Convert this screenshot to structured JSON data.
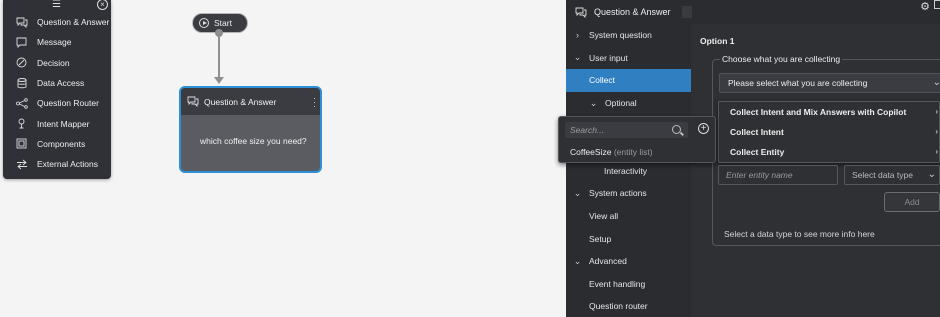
{
  "palette": {
    "items": [
      {
        "label": "Question & Answer",
        "icon": "chat-bubbles-icon"
      },
      {
        "label": "Message",
        "icon": "message-icon"
      },
      {
        "label": "Decision",
        "icon": "decision-icon"
      },
      {
        "label": "Data Access",
        "icon": "database-icon"
      },
      {
        "label": "Question Router",
        "icon": "router-icon"
      },
      {
        "label": "Intent Mapper",
        "icon": "intent-mapper-icon"
      },
      {
        "label": "Components",
        "icon": "components-icon"
      },
      {
        "label": "External Actions",
        "icon": "external-actions-icon"
      }
    ]
  },
  "flow": {
    "start_label": "Start",
    "qa_node": {
      "title": "Question & Answer",
      "body": "which coffee size you need?"
    }
  },
  "panel": {
    "title": "Question & Answer",
    "nav": [
      {
        "label": "System question",
        "type": "section",
        "chev": "›"
      },
      {
        "label": "User input",
        "type": "section",
        "chev": "⌄"
      },
      {
        "label": "Collect",
        "type": "sub",
        "active": true
      },
      {
        "label": "Optional",
        "type": "sub-chev",
        "chev": "⌄"
      },
      {
        "label": "",
        "type": "sub2"
      },
      {
        "label": "",
        "type": "sub2"
      },
      {
        "label": "Interactivity",
        "type": "sub2"
      },
      {
        "label": "System actions",
        "type": "section",
        "chev": "⌄"
      },
      {
        "label": "View all",
        "type": "sub"
      },
      {
        "label": "Setup",
        "type": "sub"
      },
      {
        "label": "Advanced",
        "type": "section",
        "chev": "⌄"
      },
      {
        "label": "Event handling",
        "type": "sub"
      },
      {
        "label": "Question router",
        "type": "sub"
      }
    ],
    "option_title": "Option 1",
    "collect_legend": "Choose what you are collecting",
    "collect_select_value": "Please select what you are collecting",
    "dropdown_options": [
      "Collect Intent and Mix Answers with Copilot",
      "Collect Intent",
      "Collect Entity"
    ],
    "entity_name_placeholder": "Enter entity name",
    "data_type_value": "Select data type",
    "add_label": "Add",
    "hint": "Select a data type to see more info here"
  },
  "search_popup": {
    "placeholder": "Search...",
    "result_name": "CoffeeSize",
    "result_type": "(entity list)"
  },
  "colors": {
    "accent": "#2f7fc1",
    "node_border": "#2d8fd5",
    "panel_bg": "#2b2c30"
  }
}
